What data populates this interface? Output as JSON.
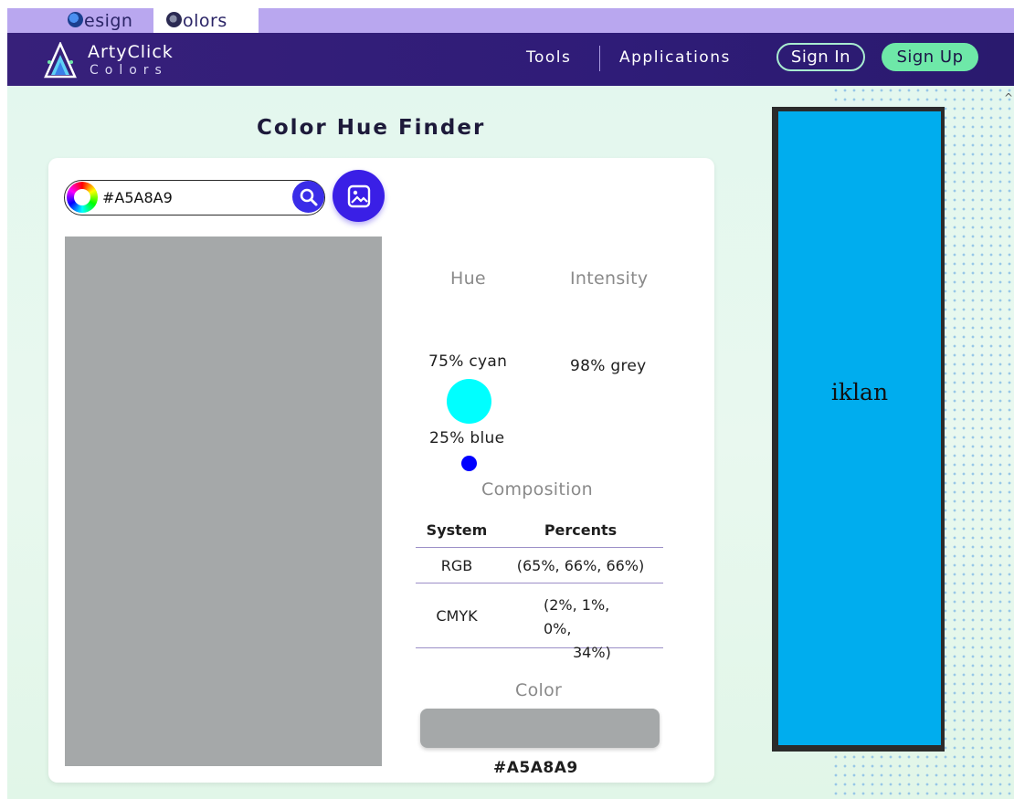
{
  "tabs": [
    {
      "label": "esign",
      "icon": "design-logo-icon"
    },
    {
      "label": "olors",
      "icon": "colors-logo-icon"
    }
  ],
  "header": {
    "brand_title": "ArtyClick",
    "brand_sub": "Colors",
    "nav": {
      "tools": "Tools",
      "applications": "Applications"
    },
    "sign_in": "Sign In",
    "sign_up": "Sign Up"
  },
  "page_title": "Color Hue Finder",
  "search": {
    "value": "#A5A8A9"
  },
  "sample_color": "#a5a8a9",
  "hue": {
    "heading": "Hue",
    "primary": "75% cyan",
    "secondary": "25% blue",
    "primary_color": "#00ffff",
    "secondary_color": "#0000ff"
  },
  "intensity": {
    "heading": "Intensity",
    "value": "98% grey"
  },
  "composition": {
    "heading": "Composition",
    "headers": [
      "System",
      "Percents"
    ],
    "rgb": {
      "system": "RGB",
      "percents": "(65%, 66%, 66%)"
    },
    "cmyk": {
      "system": "CMYK",
      "percents_line1": "(2%, 1%, 0%,",
      "percents_line2": "34%)"
    }
  },
  "color": {
    "heading": "Color",
    "hex": "#A5A8A9"
  },
  "ad": {
    "text": "iklan"
  }
}
